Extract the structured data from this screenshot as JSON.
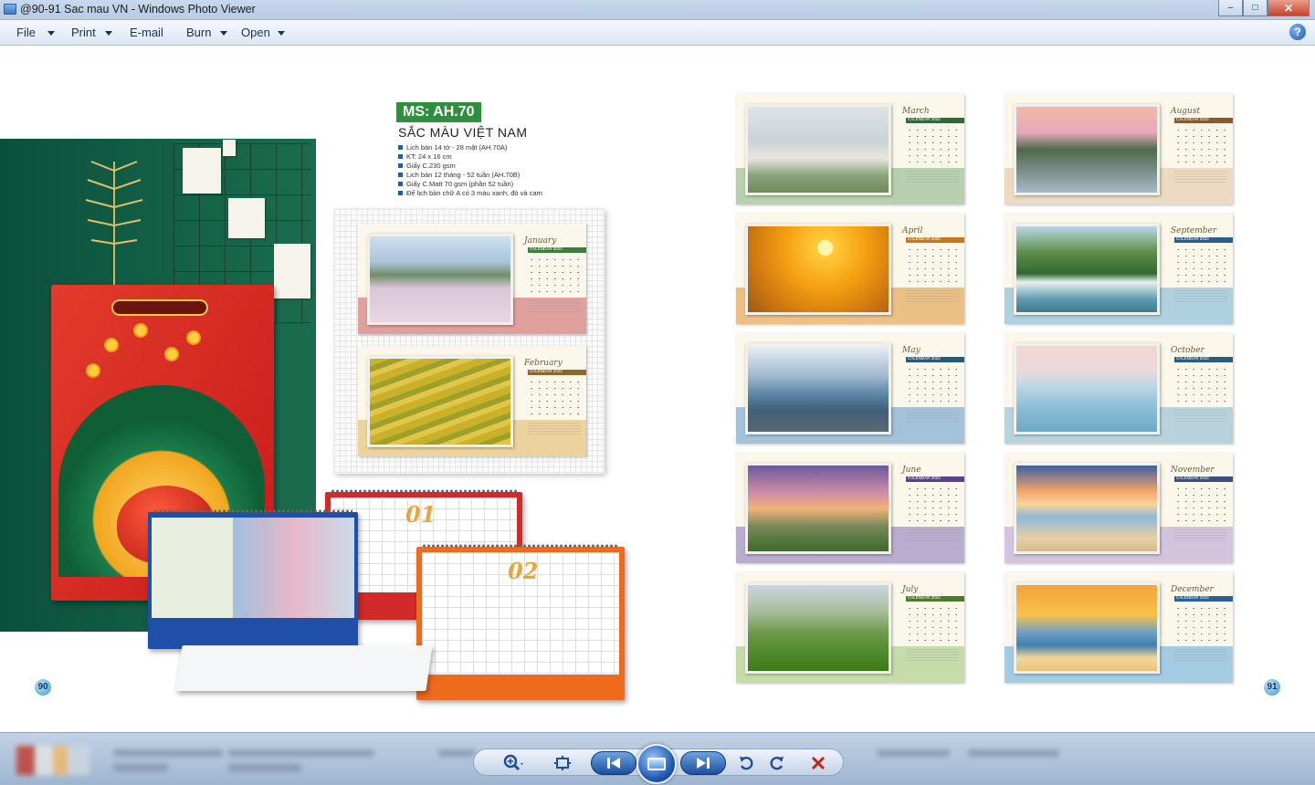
{
  "window": {
    "title": "@90-91 Sac mau VN - Windows Photo Viewer",
    "controls": {
      "minimize": "–",
      "maximize": "□",
      "close": "✕"
    }
  },
  "menu": {
    "items": [
      {
        "label": "File",
        "has_dropdown": true
      },
      {
        "label": "Print",
        "has_dropdown": true
      },
      {
        "label": "E-mail",
        "has_dropdown": false
      },
      {
        "label": "Burn",
        "has_dropdown": true
      },
      {
        "label": "Open",
        "has_dropdown": true
      }
    ],
    "help": "?"
  },
  "document": {
    "product_code": "MS: AH.70",
    "product_name": "SẮC MÀU VIỆT NAM",
    "specs": [
      "Lịch bàn 14 tờ - 28 mặt (AH.70A)",
      "KT: 24 x 16 cm",
      "Giấy C.230 gsm",
      "Lịch bàn 12 tháng - 52 tuần (AH.70B)",
      "Giấy C.Matt 70 gsm (phần 52 tuần)",
      "Đế lịch bàn chữ A có 3 màu xanh, đỏ và cam"
    ],
    "desk_calendar_pages": [
      "01",
      "02"
    ],
    "calendar_year_label": "CALENDAR 2022",
    "page_left": "90",
    "page_right": "91",
    "feature_months": [
      {
        "month": "January",
        "band": "#d98a8a",
        "strip": "#3b7d3a"
      },
      {
        "month": "February",
        "band": "#e9c98a",
        "strip": "#8a6a2a"
      }
    ],
    "grid_months": [
      {
        "month": "March",
        "band": "#a7c6a0",
        "strip": "#2f6a3a"
      },
      {
        "month": "August",
        "band": "#e8d3b8",
        "strip": "#8a5a2a"
      },
      {
        "month": "April",
        "band": "#e8b26a",
        "strip": "#c47a1a"
      },
      {
        "month": "September",
        "band": "#9cc7dc",
        "strip": "#2a5f8a"
      },
      {
        "month": "May",
        "band": "#8fb5d6",
        "strip": "#2a5a7a"
      },
      {
        "month": "October",
        "band": "#a9c9d9",
        "strip": "#2a5f7a"
      },
      {
        "month": "June",
        "band": "#a79ac8",
        "strip": "#5a3f8a"
      },
      {
        "month": "November",
        "band": "#c9b6d9",
        "strip": "#3a4f7a"
      },
      {
        "month": "July",
        "band": "#b9d39a",
        "strip": "#4a7a2a"
      },
      {
        "month": "December",
        "band": "#8fbfe0",
        "strip": "#2a5f9a"
      }
    ]
  },
  "toolbar": {
    "zoom_icon": "magnifier-icon",
    "fit_icon": "actual-size-icon",
    "previous_icon": "previous-icon",
    "slideshow_icon": "slideshow-icon",
    "next_icon": "next-icon",
    "rotate_ccw_icon": "rotate-counterclockwise-icon",
    "rotate_cw_icon": "rotate-clockwise-icon",
    "delete_icon": "delete-icon"
  }
}
